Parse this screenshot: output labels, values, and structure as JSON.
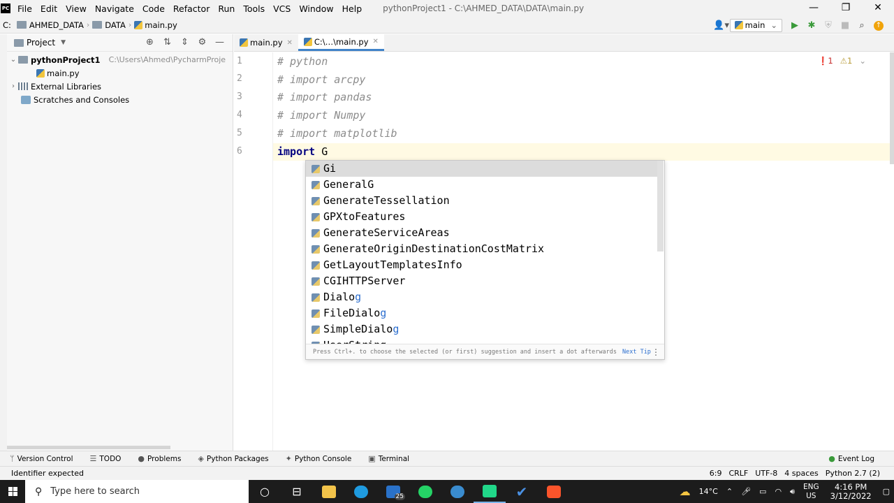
{
  "menubar": {
    "logo": "PC",
    "items": [
      "File",
      "Edit",
      "View",
      "Navigate",
      "Code",
      "Refactor",
      "Run",
      "Tools",
      "VCS",
      "Window",
      "Help"
    ],
    "title": "pythonProject1 - C:\\AHMED_DATA\\DATA\\main.py",
    "window_buttons": [
      "—",
      "❐",
      "✕"
    ]
  },
  "navbar": {
    "crumbs": [
      "C:",
      "AHMED_DATA",
      "DATA",
      "main.py"
    ],
    "run_config": "main"
  },
  "project": {
    "header": "Project",
    "tree": [
      {
        "label": "pythonProject1",
        "hint": "C:\\Users\\Ahmed\\PycharmProje",
        "type": "folder",
        "expanded": true
      },
      {
        "label": "main.py",
        "type": "file"
      },
      {
        "label": "External Libraries",
        "type": "lib"
      },
      {
        "label": "Scratches and Consoles",
        "type": "scratch"
      }
    ]
  },
  "editor": {
    "tabs": [
      {
        "label": "main.py",
        "active": false
      },
      {
        "label": "C:\\…\\main.py",
        "active": true
      }
    ],
    "lines": [
      {
        "num": "1",
        "text": "# python",
        "kind": "comment"
      },
      {
        "num": "2",
        "text": "# import arcpy",
        "kind": "comment"
      },
      {
        "num": "3",
        "text": "# import pandas",
        "kind": "comment"
      },
      {
        "num": "4",
        "text": "# import Numpy",
        "kind": "comment"
      },
      {
        "num": "5",
        "text": "# import matplotlib",
        "kind": "comment"
      },
      {
        "num": "6",
        "keyword": "import",
        "rest": " G",
        "kind": "code"
      }
    ],
    "inspections": {
      "errors": "1",
      "warnings": "1"
    }
  },
  "completion": {
    "items": [
      {
        "pre": "Gi",
        "post": "",
        "selected": true
      },
      {
        "pre": "GeneralG",
        "post": ""
      },
      {
        "pre": "GenerateTessellation",
        "post": ""
      },
      {
        "pre": "GPXtoFeatures",
        "post": ""
      },
      {
        "pre": "GenerateServiceAreas",
        "post": ""
      },
      {
        "pre": "GenerateOriginDestinationCostMatrix",
        "post": ""
      },
      {
        "pre": "GetLayoutTemplatesInfo",
        "post": ""
      },
      {
        "pre": "CGIHTTPServer",
        "post": ""
      },
      {
        "pre": "Dialo",
        "post": "g"
      },
      {
        "pre": "FileDialo",
        "post": "g"
      },
      {
        "pre": "SimpleDialo",
        "post": "g"
      },
      {
        "pre": "UserString",
        "post": ""
      }
    ],
    "footer": "Press Ctrl+. to choose the selected (or first) suggestion and insert a dot afterwards",
    "next_tip": "Next Tip"
  },
  "toolwindows": {
    "left": [
      "Version Control",
      "TODO",
      "Problems",
      "Python Packages",
      "Python Console",
      "Terminal"
    ],
    "right": "Event Log"
  },
  "status": {
    "message": "Identifier expected",
    "position": "6:9",
    "line_sep": "CRLF",
    "encoding": "UTF-8",
    "indent": "4 spaces",
    "interpreter": "Python 2.7 (2)"
  },
  "taskbar": {
    "search_placeholder": "Type here to search",
    "weather": "14°C",
    "lang_top": "ENG",
    "lang_bottom": "US",
    "time": "4:16 PM",
    "date": "3/12/2022",
    "mail_badge": "25"
  }
}
